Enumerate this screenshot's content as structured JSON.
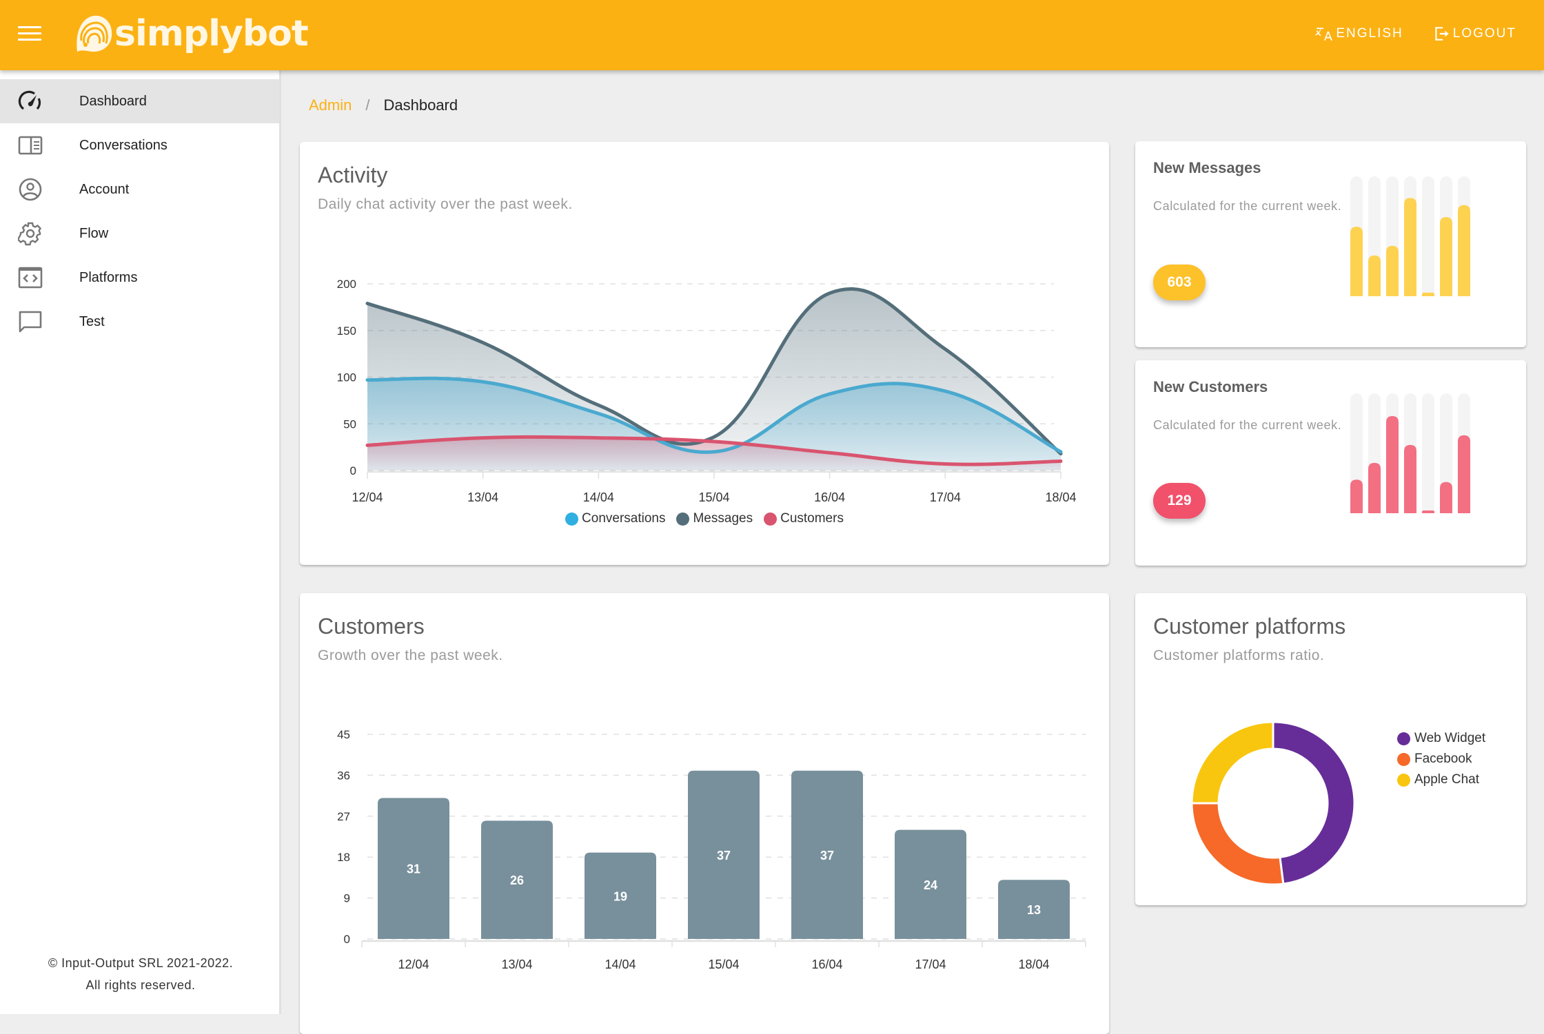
{
  "app": {
    "name": "simplybot"
  },
  "topbar": {
    "language_label": "ENGLISH",
    "logout_label": "LOGOUT"
  },
  "sidebar": {
    "items": [
      {
        "label": "Dashboard",
        "icon": "speedometer-icon",
        "active": true
      },
      {
        "label": "Conversations",
        "icon": "book-open-icon",
        "active": false
      },
      {
        "label": "Account",
        "icon": "account-circle-icon",
        "active": false
      },
      {
        "label": "Flow",
        "icon": "gear-icon",
        "active": false
      },
      {
        "label": "Platforms",
        "icon": "code-window-icon",
        "active": false
      },
      {
        "label": "Test",
        "icon": "chat-bubble-icon",
        "active": false
      }
    ],
    "footer_line1": "© Input-Output SRL 2021-2022.",
    "footer_line2": "All rights reserved."
  },
  "breadcrumb": {
    "root": "Admin",
    "separator": "/",
    "current": "Dashboard"
  },
  "colors": {
    "brand": "#fcb113",
    "conversations": "#4aa9cf",
    "messages": "#546e7a",
    "customers": "#d9546f",
    "bar": "#78909c",
    "messages_mini": "#fed251",
    "customers_mini": "#f36f82",
    "web_widget": "#662d99",
    "facebook": "#f66928",
    "apple_chat": "#f9c60f"
  },
  "activity": {
    "title": "Activity",
    "subtitle": "Daily chat activity over the past week."
  },
  "new_messages": {
    "title": "New Messages",
    "subtitle": "Calculated for the current week.",
    "count": "603",
    "bar_fractions": [
      0.58,
      0.34,
      0.42,
      0.82,
      0.03,
      0.66,
      0.76
    ]
  },
  "new_customers": {
    "title": "New Customers",
    "subtitle": "Calculated for the current week.",
    "count": "129",
    "bar_fractions": [
      0.28,
      0.42,
      0.81,
      0.57,
      0.01,
      0.26,
      0.65
    ]
  },
  "customers_card": {
    "title": "Customers",
    "subtitle": "Growth over the past week."
  },
  "platforms_card": {
    "title": "Customer platforms",
    "subtitle": "Customer platforms ratio."
  },
  "chart_data": [
    {
      "id": "activity",
      "type": "area",
      "title": "Activity",
      "x": [
        "12/04",
        "13/04",
        "14/04",
        "15/04",
        "16/04",
        "17/04",
        "18/04"
      ],
      "ylim": [
        0,
        200
      ],
      "yticks": [
        0,
        50,
        100,
        150,
        200
      ],
      "grid": true,
      "legend": "bottom",
      "series": [
        {
          "name": "Conversations",
          "values": [
            97,
            95,
            61,
            20,
            82,
            85,
            20
          ]
        },
        {
          "name": "Messages",
          "values": [
            179,
            137,
            70,
            36,
            190,
            130,
            18
          ]
        },
        {
          "name": "Customers",
          "values": [
            27,
            35,
            35,
            31,
            19,
            7,
            10
          ]
        }
      ]
    },
    {
      "id": "customers",
      "type": "bar",
      "title": "Customers",
      "categories": [
        "12/04",
        "13/04",
        "14/04",
        "15/04",
        "16/04",
        "17/04",
        "18/04"
      ],
      "values": [
        31,
        26,
        19,
        37,
        37,
        24,
        13
      ],
      "ylim": [
        0,
        45
      ],
      "yticks": [
        0,
        9,
        18,
        27,
        36,
        45
      ],
      "grid": true
    },
    {
      "id": "platforms",
      "type": "pie",
      "title": "Customer platforms",
      "legend": "right",
      "labels": [
        "Web Widget",
        "Facebook",
        "Apple Chat"
      ],
      "values": [
        48,
        27,
        25
      ]
    }
  ]
}
